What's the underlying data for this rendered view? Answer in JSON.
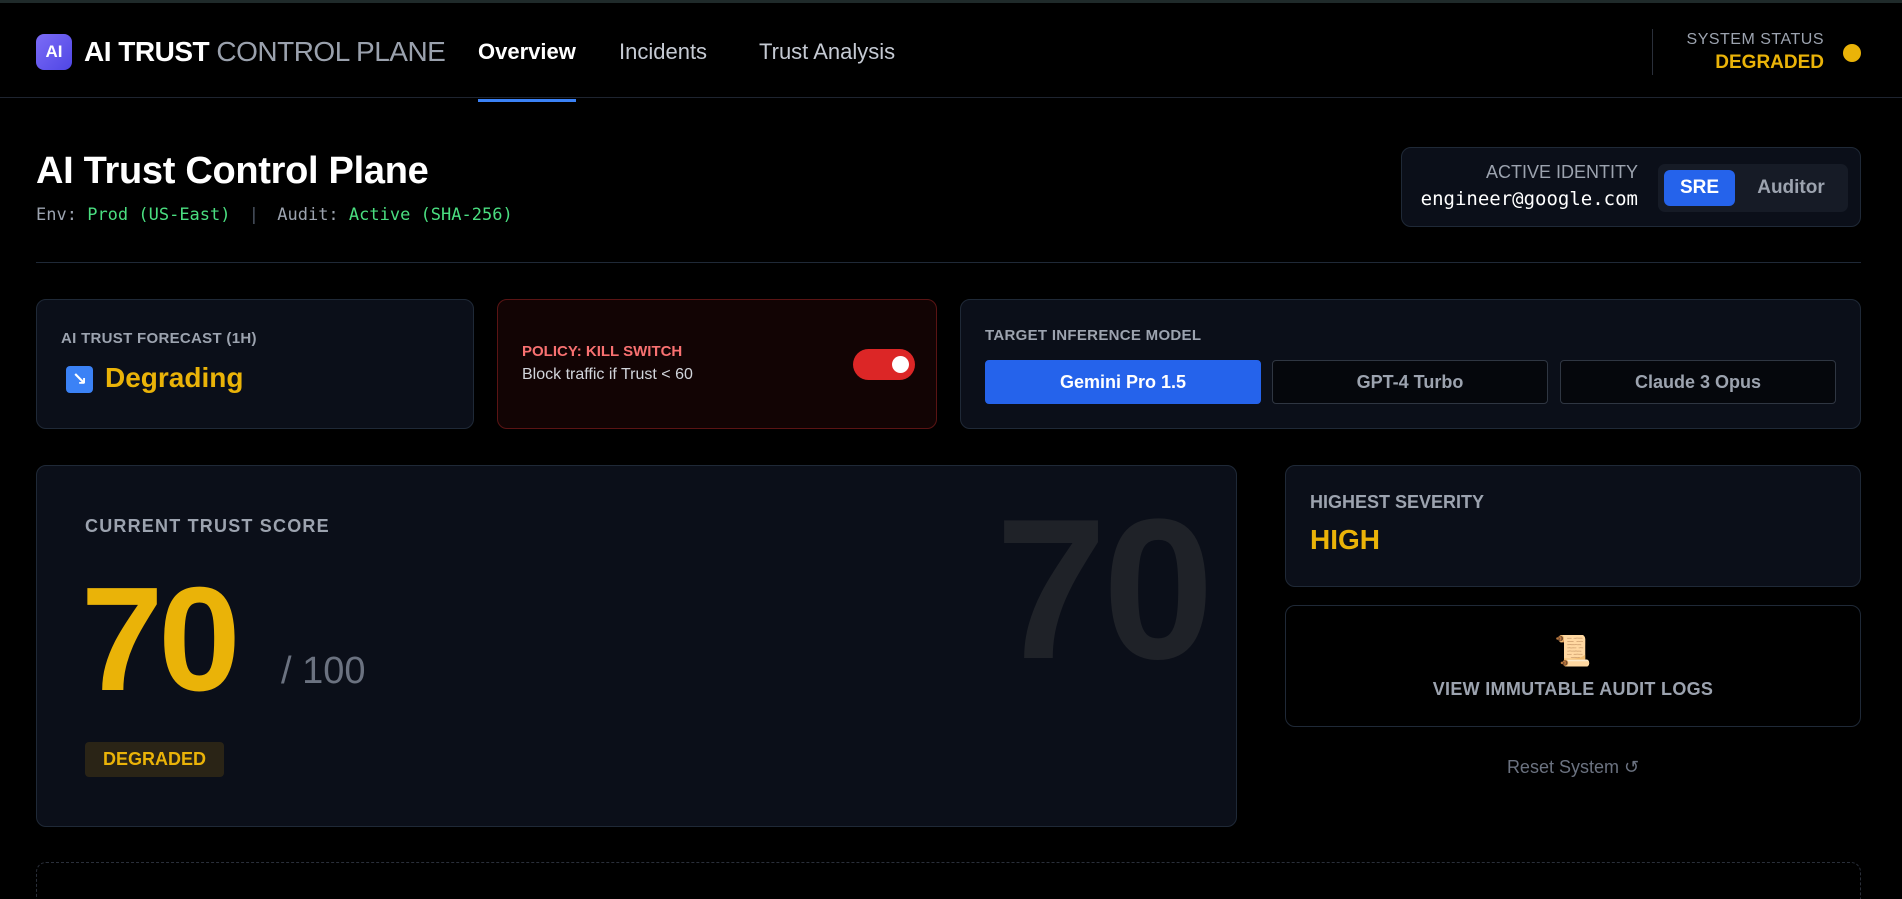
{
  "header": {
    "logo_text": "AI",
    "brand_strong": "AI TRUST",
    "brand_light": "CONTROL PLANE",
    "nav": [
      "Overview",
      "Incidents",
      "Trust Analysis"
    ],
    "status_label": "SYSTEM STATUS",
    "status_value": "DEGRADED",
    "status_color": "#eab308"
  },
  "title": {
    "main": "AI Trust Control Plane",
    "env_label": "Env:",
    "env_value": "Prod (US-East)",
    "separator": "|",
    "audit_label": "Audit:",
    "audit_value": "Active (SHA-256)"
  },
  "identity": {
    "label": "ACTIVE IDENTITY",
    "email": "engineer@google.com",
    "roles": [
      "SRE",
      "Auditor"
    ],
    "active_role": "SRE"
  },
  "forecast": {
    "label": "AI TRUST FORECAST (1H)",
    "icon": "trend-down-icon",
    "icon_glyph": "↘",
    "value": "Degrading"
  },
  "kill_switch": {
    "title": "POLICY: KILL SWITCH",
    "subtitle": "Block traffic if Trust < 60",
    "enabled": true
  },
  "models": {
    "label": "TARGET INFERENCE MODEL",
    "options": [
      "Gemini Pro 1.5",
      "GPT-4 Turbo",
      "Claude 3 Opus"
    ],
    "active": "Gemini Pro 1.5"
  },
  "trust_score": {
    "label": "CURRENT TRUST SCORE",
    "value": "70",
    "max": "/ 100",
    "status": "DEGRADED"
  },
  "severity": {
    "label": "HIGHEST SEVERITY",
    "value": "HIGH"
  },
  "audit": {
    "icon": "scroll-icon",
    "icon_glyph": "📜",
    "label": "VIEW IMMUTABLE AUDIT LOGS"
  },
  "reset": {
    "label": "Reset System ↺"
  },
  "colors": {
    "accent": "#2563eb",
    "warning": "#eab308",
    "danger": "#dc2626",
    "success": "#4ade80"
  }
}
